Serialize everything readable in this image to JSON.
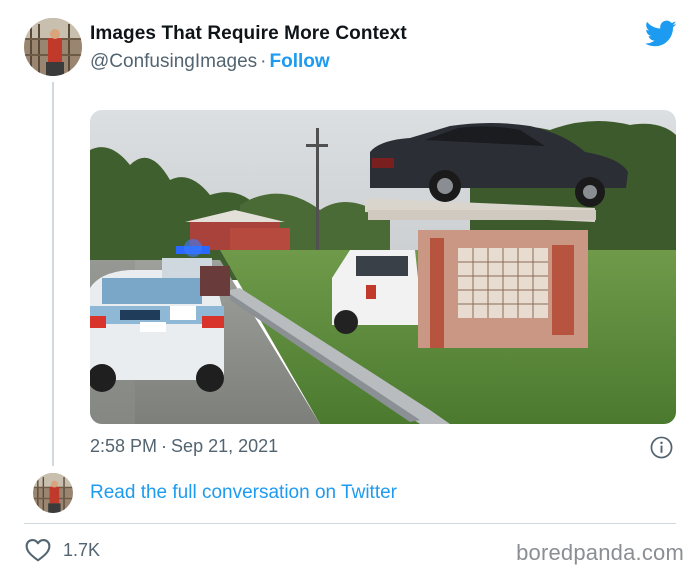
{
  "tweet": {
    "author_name": "Images That Require More Context",
    "author_handle": "@ConfusingImages",
    "separator": "·",
    "follow_label": "Follow",
    "time": "2:58 PM",
    "date": "Sep 21, 2021",
    "read_link": "Read the full conversation on Twitter",
    "like_count": "1.7K"
  },
  "icons": {
    "brand": "twitter-bird-icon",
    "info": "info-icon",
    "like": "heart-icon"
  },
  "colors": {
    "accent": "#1d9bf0",
    "text_primary": "#0f1419",
    "text_secondary": "#536471",
    "border": "#cfd9de",
    "watermark": "#8a8f95"
  },
  "watermark": "boredpanda.com"
}
